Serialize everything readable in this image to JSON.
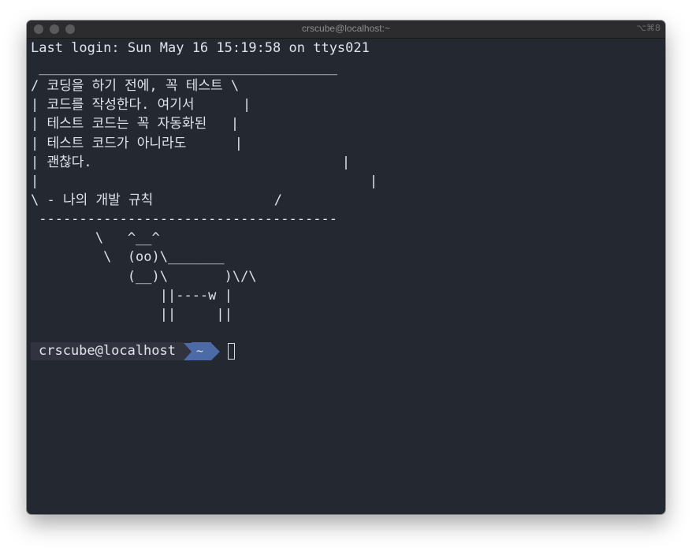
{
  "window": {
    "title": "crscube@localhost:~",
    "shortcut": "⌥⌘8"
  },
  "terminal": {
    "lines": [
      "Last login: Sun May 16 15:19:58 on ttys021",
      "",
      " _____________________________________",
      "/ 코딩을 하기 전에, 꼭 테스트 \\",
      "| 코드를 작성한다. 여기서      |",
      "| 테스트 코드는 꼭 자동화된   |",
      "| 테스트 코드가 아니라도      |",
      "| 괜찮다.                               |",
      "|                                         |",
      "\\ - 나의 개발 규칙               /",
      " -------------------------------------",
      "        \\   ^__^",
      "         \\  (oo)\\_______",
      "            (__)\\       )\\/\\",
      "                ||----w |",
      "                ||     ||"
    ],
    "prompt": {
      "user_host": "crscube@localhost",
      "directory": "~"
    }
  },
  "colors": {
    "background": "#232831",
    "text": "#dfe3ea",
    "prompt_user_bg": "#31343f",
    "prompt_dir_bg": "#4b6aa6"
  }
}
